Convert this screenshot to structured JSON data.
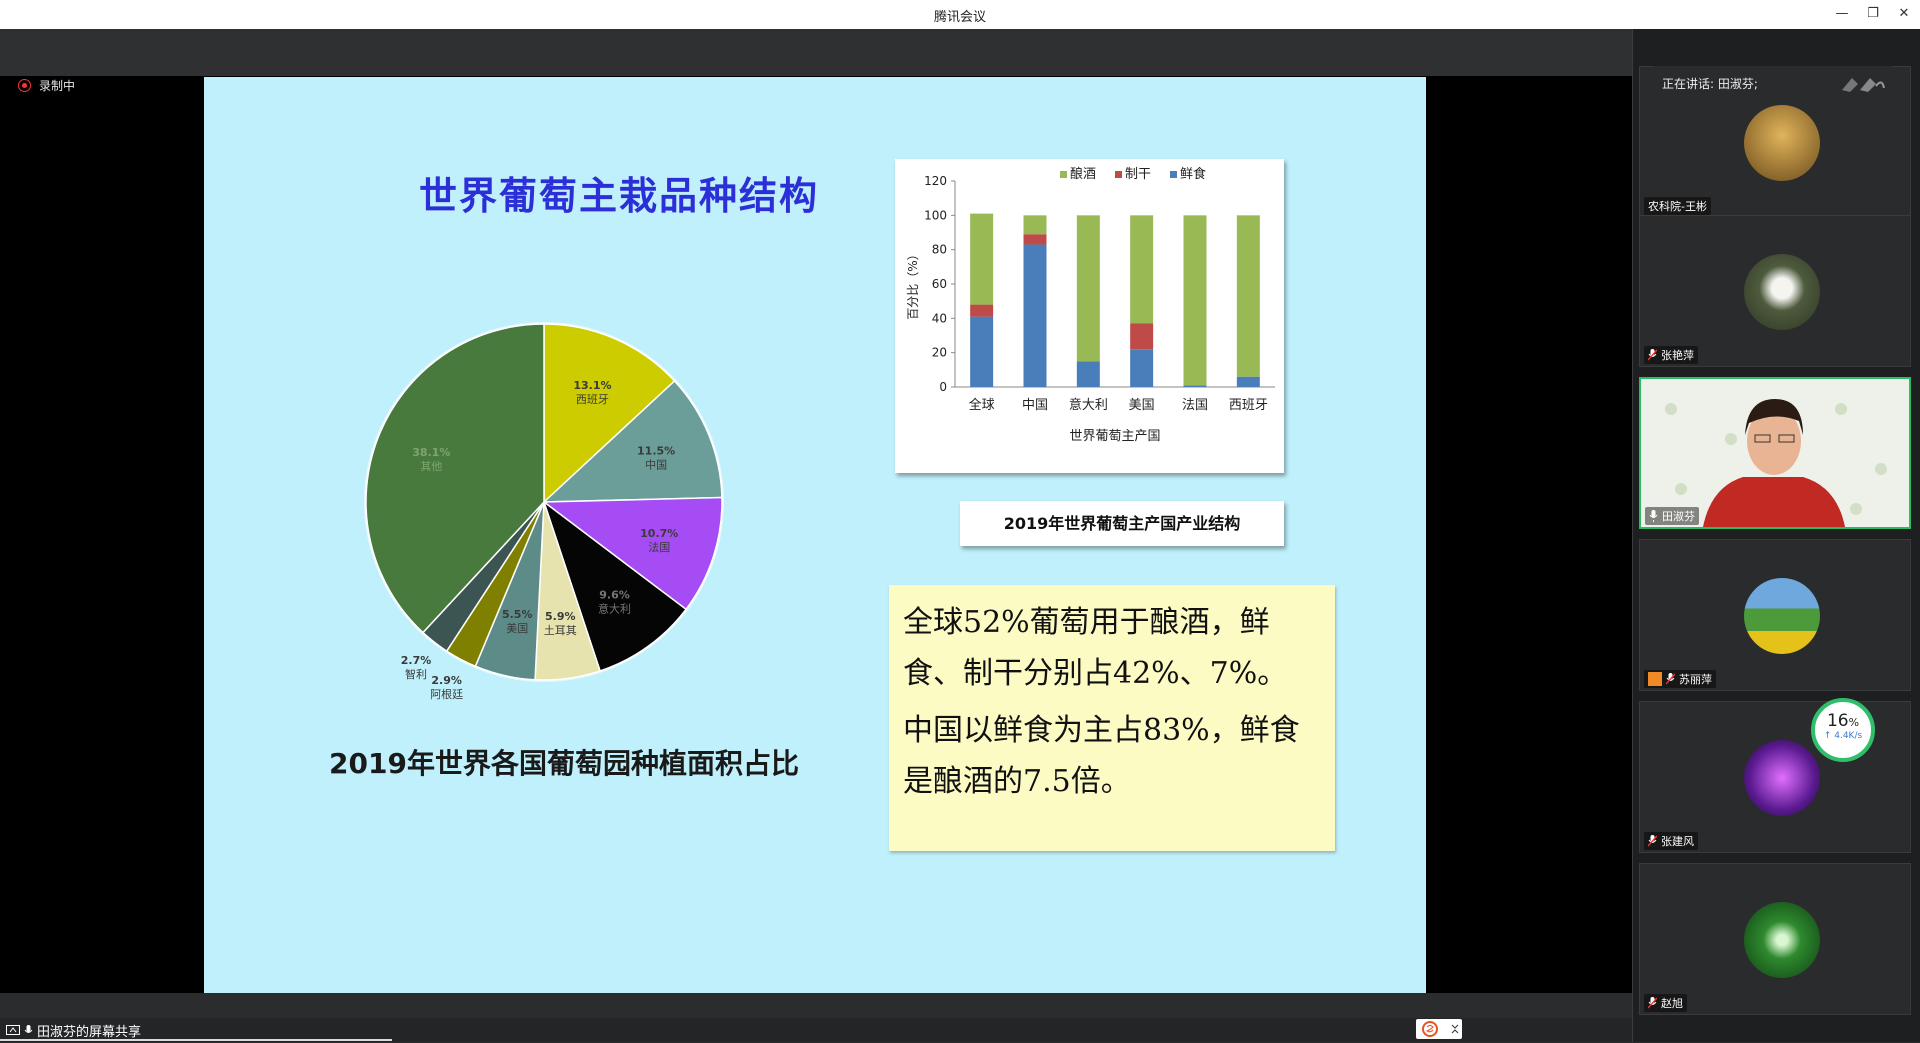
{
  "window": {
    "title": "腾讯会议"
  },
  "recording": {
    "label": "录制中"
  },
  "slide": {
    "title": "世界葡萄主栽品种结构",
    "pie_caption": "2019年世界各国葡萄园种植面积占比",
    "bar_caption": "2019年世界葡萄主产国产业结构",
    "note_lines": [
      "全球52%葡萄用于酿酒，鲜食、制干分别占42%、7%。",
      "中国以鲜食为主占83%，鲜食是酿酒的7.5倍。"
    ]
  },
  "chart_data": [
    {
      "type": "pie",
      "title": "",
      "slices": [
        {
          "label": "西班牙",
          "value": 13.1,
          "color": "#cccc00"
        },
        {
          "label": "中国",
          "value": 11.5,
          "color": "#6b9e99"
        },
        {
          "label": "法国",
          "value": 10.7,
          "color": "#a64cf5"
        },
        {
          "label": "意大利",
          "value": 9.6,
          "color": "#050505"
        },
        {
          "label": "土耳其",
          "value": 5.9,
          "color": "#e6e3ae"
        },
        {
          "label": "美国",
          "value": 5.5,
          "color": "#5d8c88"
        },
        {
          "label": "阿根廷",
          "value": 2.9,
          "color": "#7f7f00"
        },
        {
          "label": "智利",
          "value": 2.7,
          "color": "#3d5552"
        },
        {
          "label": "其他",
          "value": 38.1,
          "color": "#487a3e"
        }
      ],
      "pct_labels": [
        "13.1%",
        "11.5%",
        "10.7%",
        "9.6%",
        "5.9%",
        "5.5%",
        "2.9%",
        "2.7%",
        "38.1%"
      ]
    },
    {
      "type": "bar",
      "stacked": true,
      "categories": [
        "全球",
        "中国",
        "意大利",
        "美国",
        "法国",
        "西班牙"
      ],
      "series": [
        {
          "name": "鲜食",
          "color": "#4a7ebb",
          "values": [
            41,
            83,
            15,
            22,
            1,
            6
          ]
        },
        {
          "name": "制干",
          "color": "#be4b48",
          "values": [
            7,
            6,
            0,
            15,
            0,
            0
          ]
        },
        {
          "name": "酿酒",
          "color": "#98b954",
          "values": [
            53,
            11,
            85,
            63,
            99,
            94
          ]
        }
      ],
      "legend_order": [
        "酿酒",
        "制干",
        "鲜食"
      ],
      "xlabel": "世界葡萄主产国",
      "ylabel": "百分比（%）",
      "ylim": [
        0,
        120
      ],
      "yticks": [
        "0",
        "20",
        "40",
        "60",
        "80",
        "100",
        "120"
      ]
    }
  ],
  "sidebar": {
    "speaking": "正在讲话: 田淑芬;",
    "participants": [
      {
        "name": "农科院-王彬",
        "avatar_color": "#b8862c"
      },
      {
        "name": "张艳萍",
        "avatar_color": "#5c6b4a"
      },
      {
        "name": "田淑芬",
        "avatar_color": "#c0392b"
      },
      {
        "name": "苏丽萍",
        "avatar_color": "#3a8a3a"
      },
      {
        "name": "张建风",
        "avatar_color": "#8c2fd0"
      },
      {
        "name": "赵旭",
        "avatar_color": "#1f7a2a"
      }
    ]
  },
  "network": {
    "percent": "16",
    "percent_unit": "%",
    "speed": "↑ 4.4K/s"
  },
  "bottom": {
    "share_label": "田淑芬的屏幕共享"
  }
}
